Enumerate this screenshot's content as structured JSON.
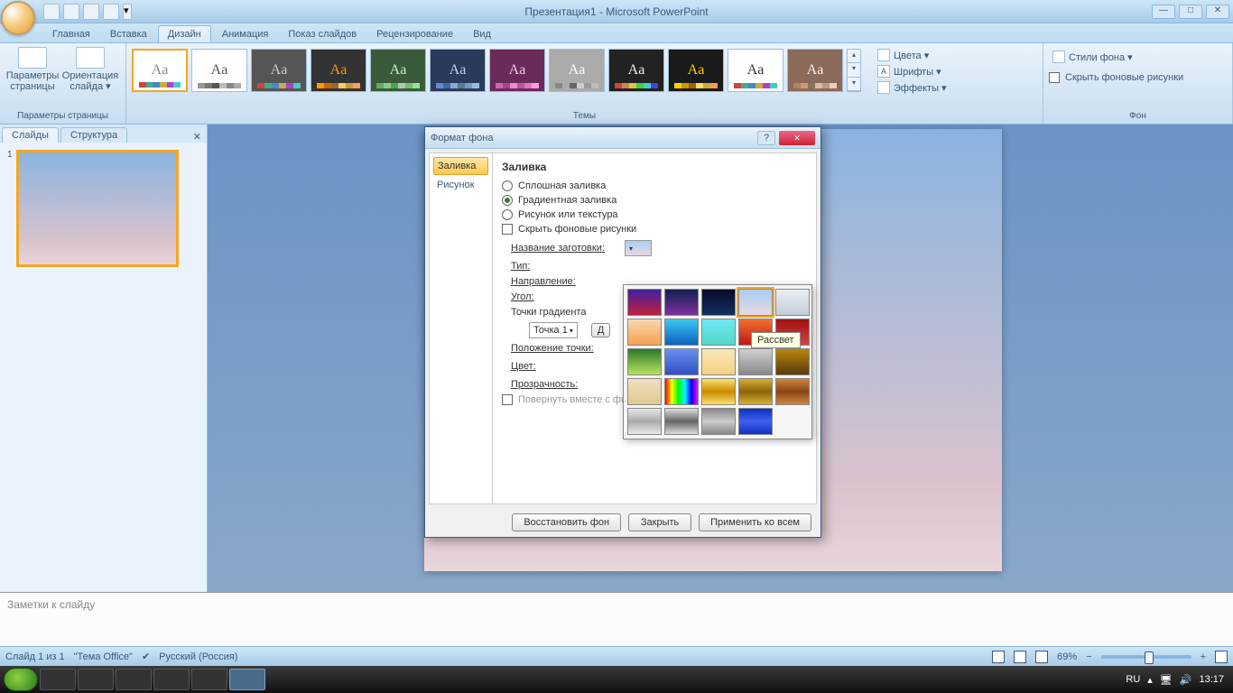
{
  "title": "Презентация1 - Microsoft PowerPoint",
  "tabs": {
    "home": "Главная",
    "insert": "Вставка",
    "design": "Дизайн",
    "anim": "Анимация",
    "show": "Показ слайдов",
    "review": "Рецензирование",
    "view": "Вид"
  },
  "ribbon": {
    "page_params": "Параметры\nстраницы",
    "orient": "Ориентация\nслайда ▾",
    "group_page": "Параметры страницы",
    "group_themes": "Темы",
    "colors": "Цвета ▾",
    "fonts": "Шрифты ▾",
    "effects": "Эффекты ▾",
    "bg_styles": "Стили фона ▾",
    "hide_bg": "Скрыть фоновые рисунки",
    "group_bg": "Фон"
  },
  "side": {
    "tab_slides": "Слайды",
    "tab_outline": "Структура",
    "thumb_num": "1"
  },
  "dialog": {
    "title": "Формат фона",
    "nav_fill": "Заливка",
    "nav_pic": "Рисунок",
    "section": "Заливка",
    "r1": "Сплошная заливка",
    "r2": "Градиентная заливка",
    "r3": "Рисунок или текстура",
    "chk_hide": "Скрыть фоновые рисунки",
    "preset": "Название заготовки:",
    "type": "Тип:",
    "direction": "Направление:",
    "angle": "Угол:",
    "stops": "Точки градиента",
    "stop": "Точка 1",
    "add": "Д",
    "pos": "Положение точки:",
    "color": "Цвет:",
    "trans": "Прозрачность:",
    "rotate": "Повернуть вместе с фигурой",
    "btn_restore": "Восстановить фон",
    "btn_close": "Закрыть",
    "btn_all": "Применить ко всем"
  },
  "tooltip": "Рассвет",
  "notes": "Заметки к слайду",
  "status": {
    "slide": "Слайд 1 из 1",
    "theme": "\"Тема Office\"",
    "lang": "Русский (Россия)",
    "zoom": "69%"
  },
  "taskbar": {
    "lang": "RU",
    "time": "13:17"
  },
  "gradients": [
    "linear-gradient(#4020a0,#c02040)",
    "linear-gradient(#102050,#8030a0)",
    "linear-gradient(#0a0a2a,#103060)",
    "linear-gradient(#a8cef5,#e8d8e0)",
    "linear-gradient(#eaeef5,#c5ccd8)",
    "linear-gradient(#f8d8b0,#f5a050)",
    "linear-gradient(#3ac8f0,#1060c0)",
    "linear-gradient(#70e8f5,#50d8c8)",
    "linear-gradient(#f07030,#c01818)",
    "linear-gradient(#a01010,#d84040)",
    "linear-gradient(#2a7a2a,#b8e060)",
    "linear-gradient(#6890f0,#3050c0)",
    "linear-gradient(#f8e8b8,#f5d080)",
    "linear-gradient(#d0d0d0,#888888)",
    "linear-gradient(#b8860b,#5a3a10)",
    "linear-gradient(#f0e0c0,#e0c890)",
    "linear-gradient(90deg,#f00,#ff0,#0f0,#0ff,#00f,#f0f)",
    "linear-gradient(#ffe070,#c88a00,#ffe070)",
    "linear-gradient(#d4af37,#8b6508,#d4af37)",
    "linear-gradient(#cd853f,#8b4513,#cd853f)",
    "linear-gradient(#e8e8e8,#aaa,#e8e8e8)",
    "linear-gradient(#ddd,#666,#ddd)",
    "linear-gradient(#888,#ccc,#888)",
    "linear-gradient(#1030c0,#4060f0,#1030c0)"
  ]
}
